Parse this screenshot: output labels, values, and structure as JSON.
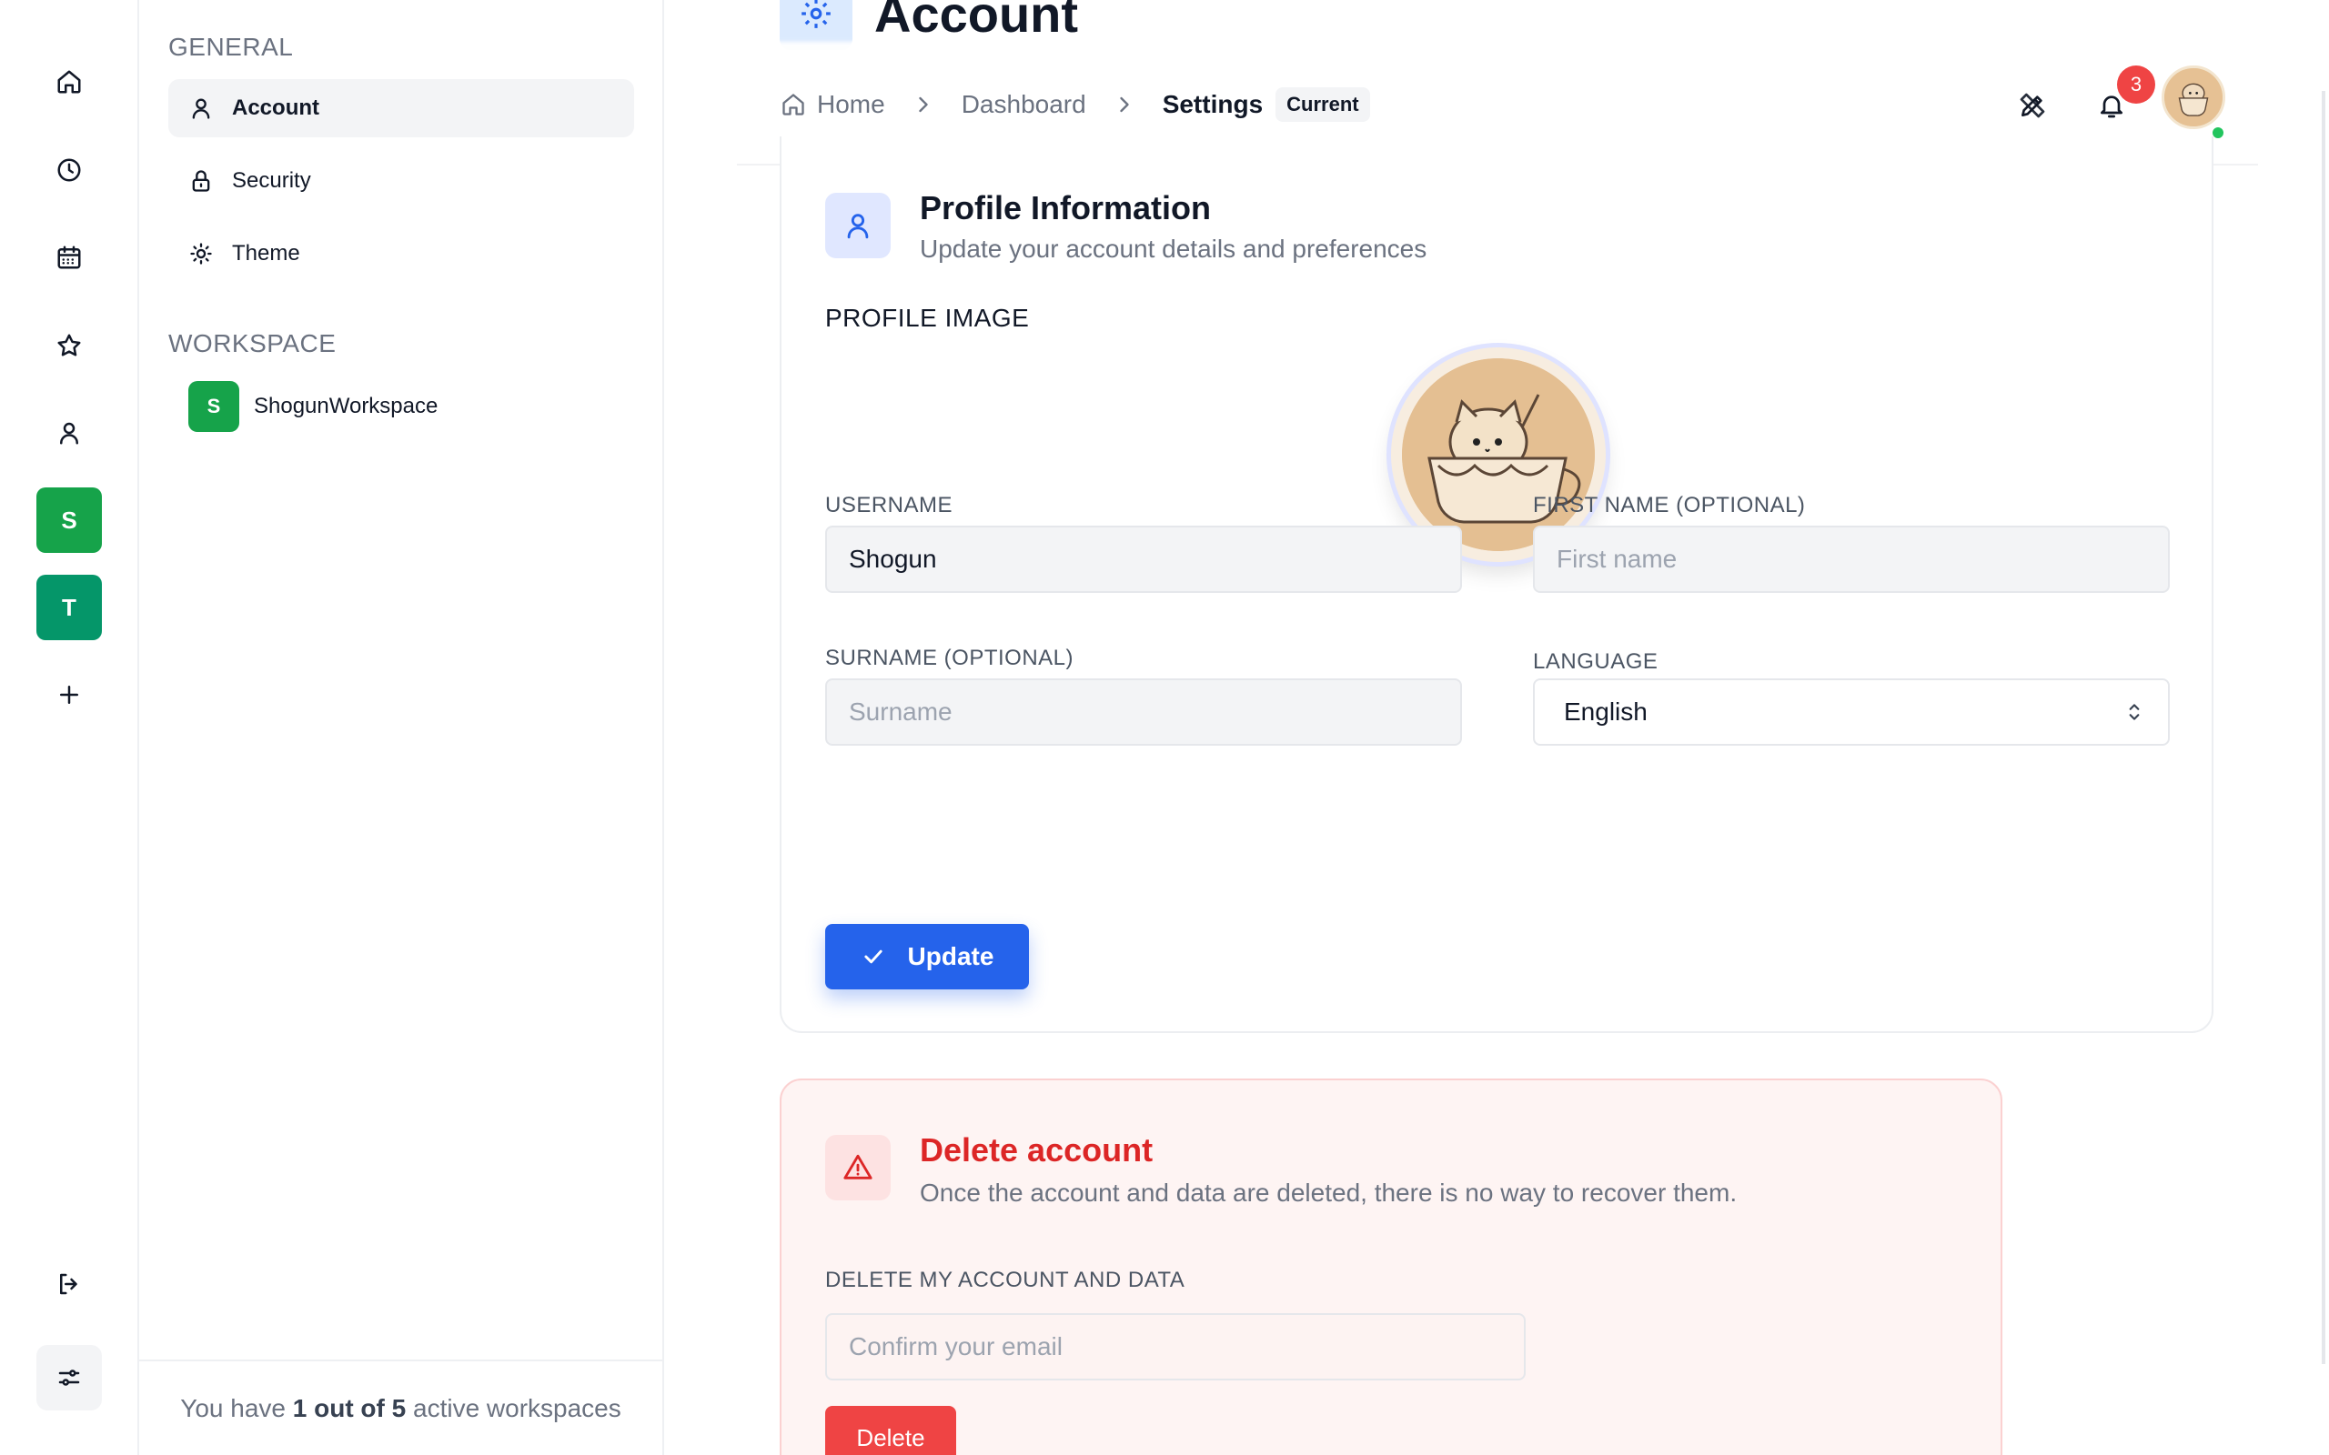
{
  "rail": {
    "workspace_badges": [
      "S",
      "T"
    ],
    "colors": {
      "ws_s": "#16a34a",
      "ws_t": "#059669"
    }
  },
  "sidebar": {
    "general_heading": "GENERAL",
    "items": [
      {
        "label": "Account",
        "icon": "user-icon",
        "active": true
      },
      {
        "label": "Security",
        "icon": "lock-icon",
        "active": false
      },
      {
        "label": "Theme",
        "icon": "sun-icon",
        "active": false
      }
    ],
    "workspace_heading": "WORKSPACE",
    "workspace": {
      "badge": "S",
      "name": "ShogunWorkspace"
    },
    "footer": {
      "prefix": "You have ",
      "count": "1 out of 5",
      "suffix": " active workspaces"
    }
  },
  "header": {
    "title": "Account"
  },
  "breadcrumb": {
    "home": "Home",
    "dashboard": "Dashboard",
    "current": "Settings",
    "tag": "Current"
  },
  "notifications": {
    "count": "3"
  },
  "profile": {
    "title": "Profile Information",
    "subtitle": "Update your account details and preferences",
    "image_label": "PROFILE IMAGE",
    "username_label": "USERNAME",
    "username_value": "Shogun",
    "firstname_label": "FIRST NAME (OPTIONAL)",
    "firstname_placeholder": "First name",
    "surname_label": "SURNAME (OPTIONAL)",
    "surname_placeholder": "Surname",
    "language_label": "LANGUAGE",
    "language_value": "English",
    "update_button": "Update"
  },
  "danger": {
    "title": "Delete account",
    "subtitle": "Once the account and data are deleted, there is no way to recover them.",
    "field_label": "DELETE MY ACCOUNT AND DATA",
    "email_placeholder": "Confirm your email",
    "delete_button": "Delete"
  },
  "colors": {
    "accent": "#2563eb",
    "danger": "#dc2626",
    "success": "#16a34a"
  }
}
